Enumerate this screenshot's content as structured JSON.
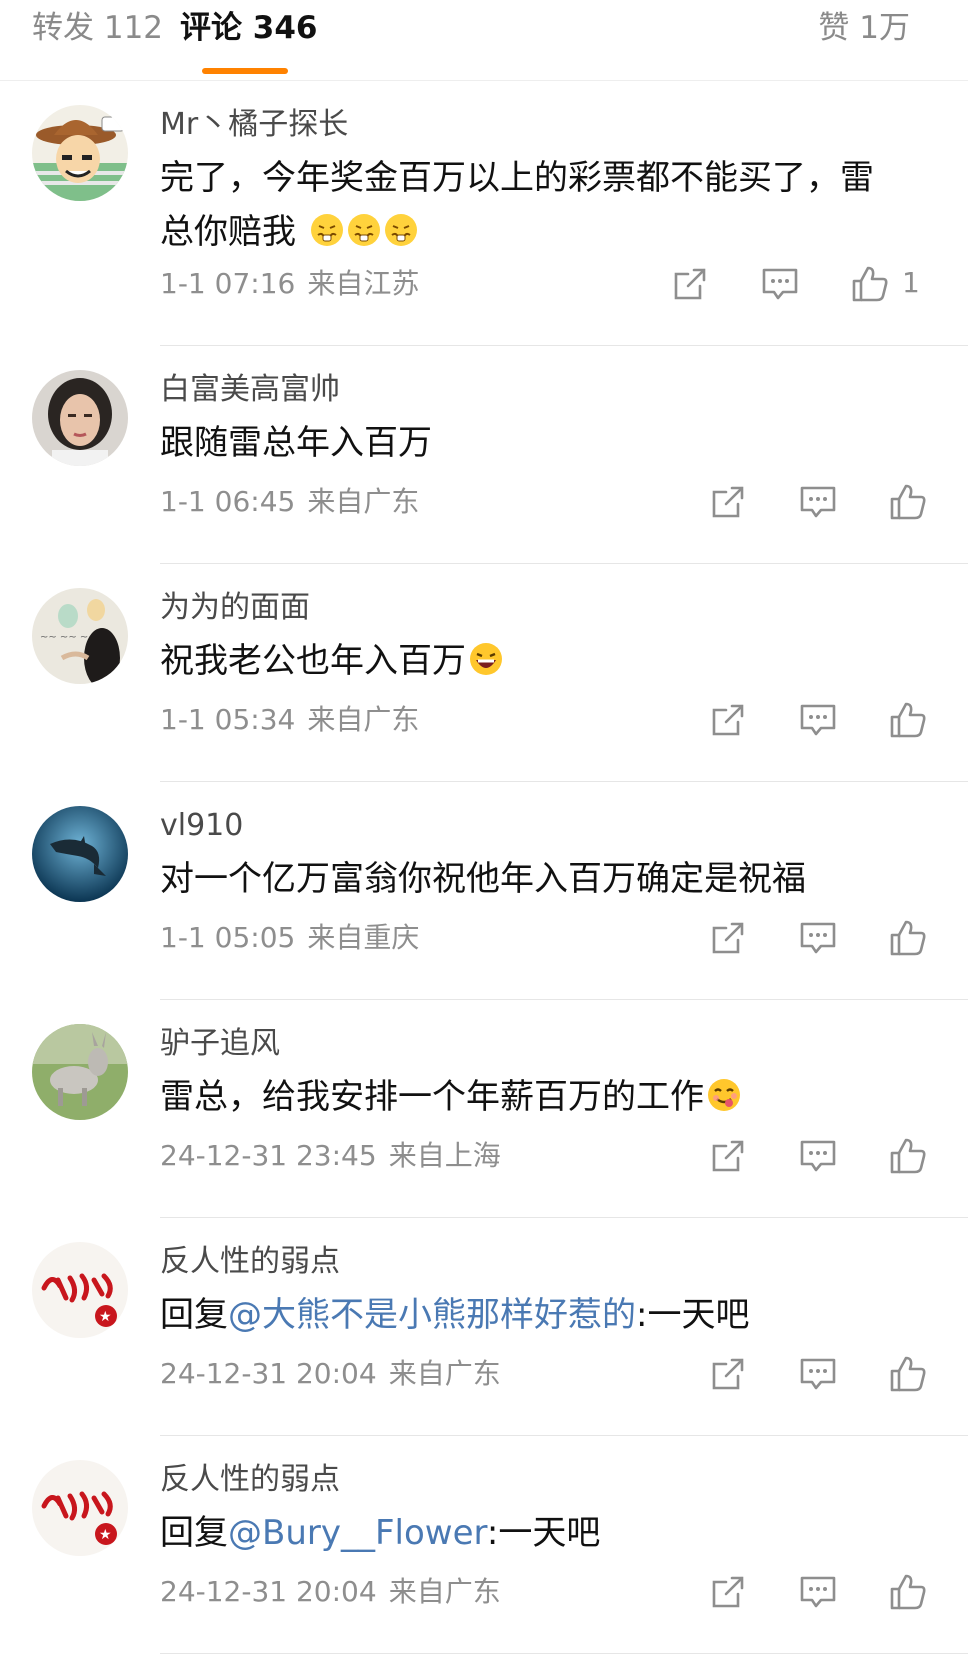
{
  "tabs": {
    "repost": "转发 112",
    "comment": "评论 346",
    "like": "赞 1万",
    "accent": "#ff8200"
  },
  "colors": {
    "mention": "#4a79b3",
    "meta": "#8e8e8e"
  },
  "comments": [
    {
      "username": "Mr丶橘子探长",
      "text_lines": [
        "完了，今年奖金百万以上的彩票都不能买了，雷",
        "总你赔我"
      ],
      "emoji": [
        "pinched-face-emoji",
        "pinched-face-emoji",
        "pinched-face-emoji"
      ],
      "time": "1-1 07:16",
      "location": "来自江苏",
      "likes": "1",
      "avatar": "cowboy-cartoon-avatar"
    },
    {
      "username": "白富美高富帅",
      "text": "跟随雷总年入百万",
      "time": "1-1 06:45",
      "location": "来自广东",
      "avatar": "woman-portrait-avatar"
    },
    {
      "username": "为为的面面",
      "text": "祝我老公也年入百万",
      "emoji": [
        "laughing-face-emoji"
      ],
      "time": "1-1 05:34",
      "location": "来自广东",
      "avatar": "girl-wall-avatar"
    },
    {
      "username": "vl910",
      "text": "对一个亿万富翁你祝他年入百万确定是祝福",
      "time": "1-1 05:05",
      "location": "来自重庆",
      "avatar": "dolphin-avatar"
    },
    {
      "username": "驴子追风",
      "text": "雷总，给我安排一个年薪百万的工作",
      "emoji": [
        "yummy-face-emoji"
      ],
      "time": "24-12-31 23:45",
      "location": "来自上海",
      "avatar": "donkey-avatar"
    },
    {
      "username": "反人性的弱点",
      "reply_prefix": "回复",
      "mention": "@大熊不是小熊那样好惹的",
      "text": ":一天吧",
      "time": "24-12-31 20:04",
      "location": "来自广东",
      "avatar": "calligraphy-avatar"
    },
    {
      "username": "反人性的弱点",
      "reply_prefix": "回复",
      "mention": "@Bury__Flower",
      "text": ":一天吧",
      "time": "24-12-31 20:04",
      "location": "来自广东",
      "avatar": "calligraphy-avatar"
    }
  ]
}
